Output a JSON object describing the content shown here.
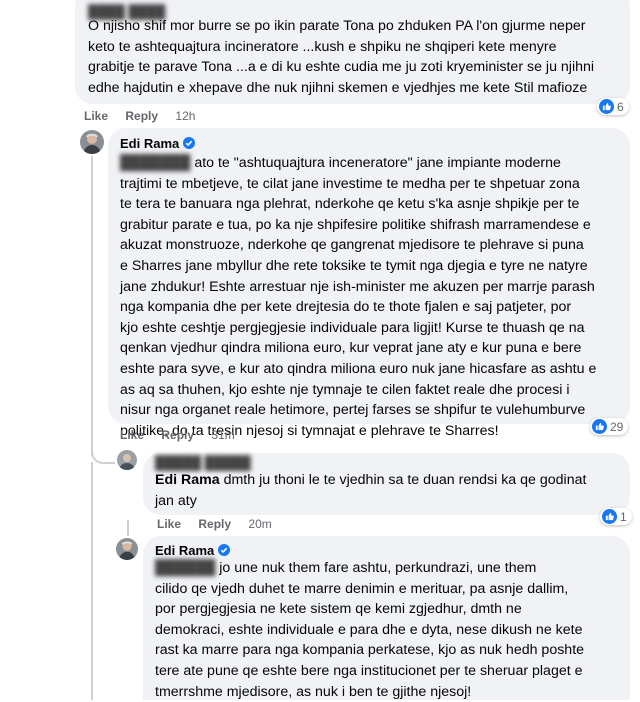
{
  "comments": [
    {
      "author": "",
      "text_lines": [
        "O njisho shif mor burre se po ikin parate Tona po zhduken PA l'on gjurme neper",
        "keto te ashtequajtura incineratore ...kush e shpiku ne shqiperi kete menyre",
        "grabitje te parave Tona ...a e di ku eshte cudia me ju zoti kryeminister se ju njihni",
        "edhe hajdutin e xhepave dhe nuk njihni skemen e vjedhjes me kete Stil mafioze"
      ],
      "actions": {
        "like": "Like",
        "reply": "Reply",
        "time": "12h"
      },
      "reactions": "6"
    },
    {
      "author": "Edi Rama",
      "verified": true,
      "text_lines": [
        "ato te \"ashtuquajtura inceneratore\" jane impiante moderne",
        "trajtimi te mbetjeve, te cilat jane investime te medha per te shpetuar zona",
        "te tera te banuara nga plehrat, nderkohe qe ketu s'ka asnje shpikje per te",
        "grabitur parate e tua, po ka nje shpifesire politike shifrash marramendese e",
        "akuzat monstruoze, nderkohe qe gangrenat mjedisore te plehrave si puna",
        "e Sharres jane mbyllur dhe rete toksike te tymit nga djegia e tyre ne natyre",
        "jane zhdukur! Eshte arrestuar nje ish-minister me akuzen per marrje parash",
        "nga kompania dhe per kete drejtesia do te thote fjalen e saj patjeter, por",
        "kjo eshte ceshtje pergjegjesie individuale para ligjit! Kurse te thuash qe na",
        "qenkan vjedhur qindra miliona euro, kur veprat jane aty e kur puna e bere",
        "eshte para syve, e kur ato qindra miliona euro nuk jane hicasfare as ashtu e",
        "as aq sa thuhen, kjo eshte nje tymnaje te cilen faktet reale dhe procesi i",
        "nisur nga organet reale hetimore, pertej farses se shpifur te vulehumburve",
        "politike, do ta tresin njesoj si tymnajat e plehrave te Sharres!"
      ],
      "actions": {
        "like": "Like",
        "reply": "Reply",
        "time": "31m"
      },
      "reactions": "29"
    },
    {
      "author": "",
      "mention": "Edi Rama",
      "text_lines": [
        " dmth ju thoni le te vjedhin sa te duan rendsi ka qe godinat",
        "jan aty"
      ],
      "actions": {
        "like": "Like",
        "reply": "Reply",
        "time": "20m"
      },
      "reactions": "1"
    },
    {
      "author": "Edi Rama",
      "verified": true,
      "text_lines": [
        " jo une nuk them fare ashtu, perkundrazi, une them",
        "cilido qe vjedh duhet te marre denimin e merituar, pa asnje dallim,",
        "por pergjegjesia ne kete sistem qe kemi zgjedhur, dmth ne",
        "demokraci, eshte individuale e para dhe e dyta, nese dikush ne kete",
        "rast ka marre para nga kompania perkatese, kjo as nuk hedh poshte",
        "tere ate pune qe eshte bere nga institucionet per te sheruar plaget e",
        "tmerrshme mjedisore, as nuk i ben te gjithe njesoj!"
      ]
    }
  ],
  "colors": {
    "bubble": "#f0f2f5",
    "like_blue": "#1877f2",
    "meta_gray": "#65676b",
    "thread_line": "#ced0d4"
  }
}
